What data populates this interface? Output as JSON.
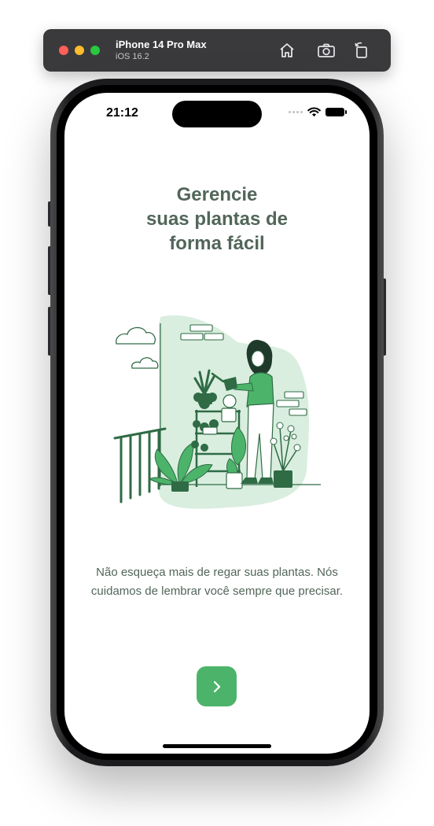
{
  "simulator": {
    "device_name": "iPhone 14 Pro Max",
    "os_version": "iOS 16.2",
    "home_icon": "home-icon",
    "screenshot_icon": "camera-icon",
    "rotate_icon": "rotate-icon"
  },
  "status_bar": {
    "time": "21:12",
    "wifi_icon": "wifi-icon",
    "battery_icon": "battery-icon"
  },
  "onboarding": {
    "title_lines": [
      "Gerencie",
      "suas plantas de",
      "forma fácil"
    ],
    "illustration_icon": "woman-watering-plants-illustration",
    "description": "Não esqueça mais de regar suas plantas. Nós cuidamos de lembrar você sempre que precisar.",
    "next_icon": "chevron-right-icon"
  },
  "colors": {
    "title": "#52665a",
    "accent_green": "#4cb46a",
    "plant_green": "#2f6b45",
    "light_green": "#d9eedf"
  }
}
